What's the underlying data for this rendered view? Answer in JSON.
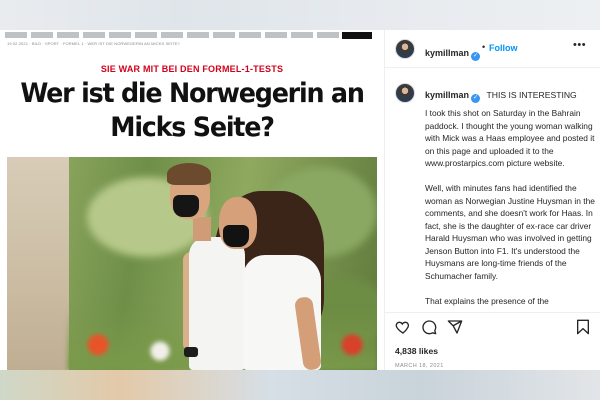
{
  "article": {
    "breadcrumb": "19.02.2021 · BILD · SPORT · FORMEL 1 · WER IST DIE NORWEGERIN AN MICKS SEITE?",
    "kicker": "SIE WAR MIT BEI DEN FORMEL-1-TESTS",
    "headline_line1": "Wer ist die Norwegerin an",
    "headline_line2": "Micks Seite?"
  },
  "post": {
    "username": "kymillman",
    "follow_label": "Follow",
    "separator": "•",
    "more_icon": "more-horizontal-icon",
    "caption_title": "THIS IS INTERESTING",
    "caption_paragraphs": [
      "I took this shot on Saturday in the Bahrain paddock. I thought the young woman walking with Mick was a Haas employee and posted it on this page and uploaded it to the www.prostarpics.com picture website.",
      "Well, with minutes fans had identified the woman as Norwegian Justine Huysman in the comments, and she doesn't work for Haas. In fact, she is the daughter of ex-race car driver Harald Huysman who was involved in getting Jenson Button into F1. It's understood the Huysmans are long-time friends of the Schumacher family.",
      "That explains the presence of the"
    ],
    "likes": "4,838 likes",
    "date": "MARCH 18, 2021",
    "icons": [
      "heart-icon",
      "comment-icon",
      "share-icon",
      "bookmark-icon"
    ],
    "accent_color": "#0095f6",
    "verified_color": "#3897f0"
  },
  "colors": {
    "kicker": "#d0021b",
    "headline": "#111111"
  }
}
